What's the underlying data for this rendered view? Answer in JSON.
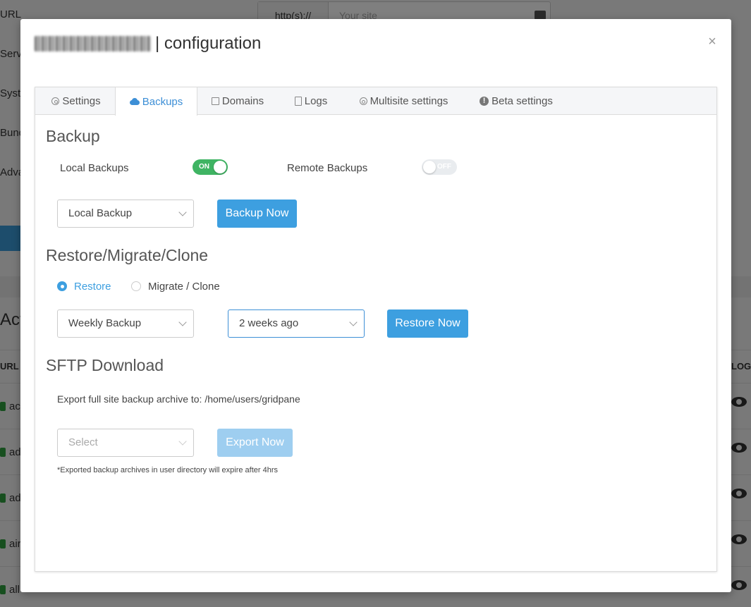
{
  "background": {
    "labels": [
      "URL",
      "Serv",
      "Syst",
      "Bund",
      "Adva",
      "Act",
      "URL",
      "LOG"
    ],
    "url_prefix": "http(s)://",
    "url_placeholder": "Your site",
    "rows": [
      "ac",
      "ad",
      "ad",
      "air",
      "all"
    ]
  },
  "modal": {
    "title_suffix": "| configuration",
    "close_label": "×"
  },
  "tabs": [
    {
      "label": "Settings",
      "icon": "gear-icon"
    },
    {
      "label": "Backups",
      "icon": "cloud-upload-icon",
      "active": true
    },
    {
      "label": "Domains",
      "icon": "edit-icon"
    },
    {
      "label": "Logs",
      "icon": "file-icon"
    },
    {
      "label": "Multisite settings",
      "icon": "gear-icon"
    },
    {
      "label": "Beta settings",
      "icon": "info-icon",
      "icon_glyph": "!"
    }
  ],
  "backup": {
    "title": "Backup",
    "local_label": "Local Backups",
    "local_toggle": "ON",
    "remote_label": "Remote Backups",
    "remote_toggle": "OFF",
    "select_value": "Local Backup",
    "button": "Backup Now"
  },
  "restore": {
    "title": "Restore/Migrate/Clone",
    "radio_restore": "Restore",
    "radio_migrate": "Migrate / Clone",
    "select_type": "Weekly Backup",
    "select_time": "2 weeks ago",
    "button": "Restore Now"
  },
  "sftp": {
    "title": "SFTP Download",
    "description": "Export full site backup archive to: /home/users/gridpane",
    "select_placeholder": "Select",
    "button": "Export Now",
    "note": "*Exported backup archives in user directory will expire after 4hrs"
  },
  "colors": {
    "accent": "#3d9fe0",
    "toggle_on": "#3fb463",
    "active_tab": "#3d8fd6"
  }
}
